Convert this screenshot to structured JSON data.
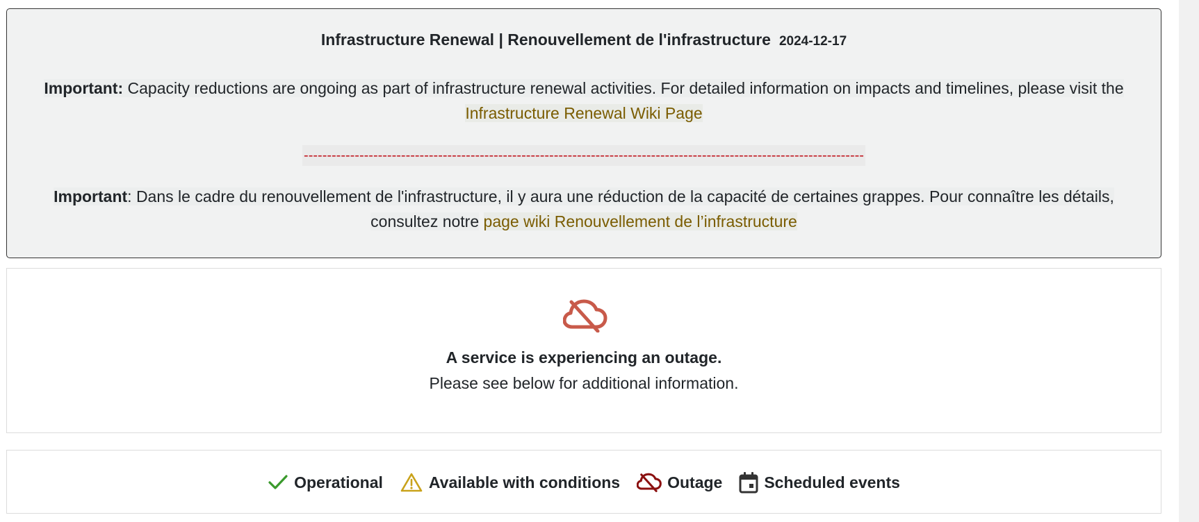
{
  "announcement": {
    "title": "Infrastructure Renewal | Renouvellement de l'infrastructure",
    "date": "2024-12-17",
    "en_label": "Important:",
    "en_text": "Capacity reductions are ongoing as part of infrastructure renewal activities. For detailed information on impacts and timelines, please visit the",
    "en_link": "Infrastructure Renewal Wiki Page",
    "divider": "-------------------------------------------------------------------------------------------------------------------------",
    "fr_label": "Important",
    "fr_text": ": Dans le cadre du renouvellement de l'infrastructure, il y aura une réduction de la capacité de certaines grappes. Pour connaître les détails, consultez notre",
    "fr_link": "page wiki Renouvellement de l’infrastructure"
  },
  "status": {
    "icon": "cloud-off-icon",
    "headline": "A service is experiencing an outage.",
    "subtext": "Please see below for additional information."
  },
  "legend": {
    "items": [
      {
        "label": "Operational",
        "icon": "check-icon",
        "color": "#3a9a2c"
      },
      {
        "label": "Available with conditions",
        "icon": "warning-icon",
        "color": "#c9a21a"
      },
      {
        "label": "Outage",
        "icon": "cloud-off-icon",
        "color": "#8b1010"
      },
      {
        "label": "Scheduled events",
        "icon": "calendar-icon",
        "color": "#333333"
      }
    ]
  },
  "colors": {
    "outage_icon": "#c85a4a",
    "link": "#7a5c00",
    "divider": "#c0111a"
  }
}
